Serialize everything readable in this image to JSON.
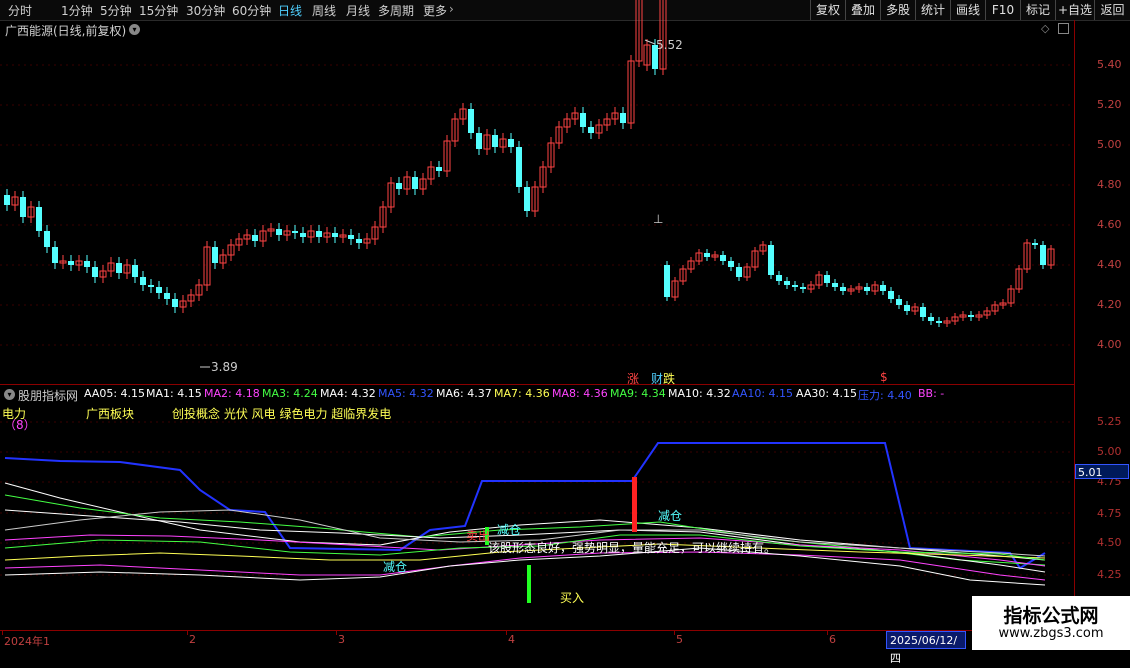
{
  "toolbar": {
    "periods": [
      "分时",
      "1分钟",
      "5分钟",
      "15分钟",
      "30分钟",
      "60分钟",
      "日线",
      "周线",
      "月线",
      "多周期",
      "更多"
    ],
    "active_period": "日线",
    "right_buttons": [
      "复权",
      "叠加",
      "多股",
      "统计",
      "画线",
      "F10",
      "标记",
      "+自选",
      "返回"
    ]
  },
  "main_chart": {
    "title": "广西能源(日线,前复权)",
    "y_labels": [
      "5.40",
      "5.20",
      "5.00",
      "4.80",
      "4.60",
      "4.40",
      "4.20",
      "4.00"
    ],
    "high_label": "5.52",
    "low_label": "3.89",
    "marker_zhang": "涨",
    "marker_cai": "财",
    "marker_die": "跌",
    "marker_s": "$",
    "marker_t": "⊥"
  },
  "indicator": {
    "name": "股朋指标网",
    "values": [
      {
        "label": "AA05: 4.15",
        "color": "#ffffff"
      },
      {
        "label": "MA1: 4.15",
        "color": "#ffffff"
      },
      {
        "label": "MA2: 4.18",
        "color": "#ff44ff"
      },
      {
        "label": "MA3: 4.24",
        "color": "#44ff44"
      },
      {
        "label": "MA4: 4.32",
        "color": "#ffffff"
      },
      {
        "label": "MA5: 4.32",
        "color": "#3355ff"
      },
      {
        "label": "MA6: 4.37",
        "color": "#ffffff"
      },
      {
        "label": "MA7: 4.36",
        "color": "#ffff55"
      },
      {
        "label": "MA8: 4.36",
        "color": "#ff44ff"
      },
      {
        "label": "MA9: 4.34",
        "color": "#44ff44"
      },
      {
        "label": "MA10: 4.32",
        "color": "#ffffff"
      },
      {
        "label": "AA10: 4.15",
        "color": "#3355ff"
      },
      {
        "label": "AA30: 4.15",
        "color": "#ffffff"
      },
      {
        "label": "压力: 4.40",
        "color": "#3355ff"
      },
      {
        "label": "BB: -",
        "color": "#ff44ff"
      }
    ],
    "sector_label": "电力",
    "sector_count": "（8）",
    "region": "广西板块",
    "concepts": "创投概念 光伏 风电 绿色电力 超临界发电",
    "y_labels": [
      "5.25",
      "5.00",
      "4.75",
      "4.50",
      "4.25"
    ],
    "current_price": "5.01",
    "annotations": {
      "reduce1": "减仓",
      "reduce2": "减仓",
      "reduce3": "减仓",
      "sell": "卖出",
      "buy": "买入",
      "comment": "该股形态良好，强势明显，量能充足，可以继续持有。"
    }
  },
  "date_axis": {
    "labels": [
      "2024年1",
      "2",
      "3",
      "4",
      "5",
      "6"
    ],
    "cursor_date": "2025/06/12/四"
  },
  "watermark": {
    "title": "指标公式网",
    "url": "www.zbgs3.com"
  },
  "colors": {
    "up": "#ff4444",
    "down": "#54ffff",
    "axis": "#8b0000"
  }
}
